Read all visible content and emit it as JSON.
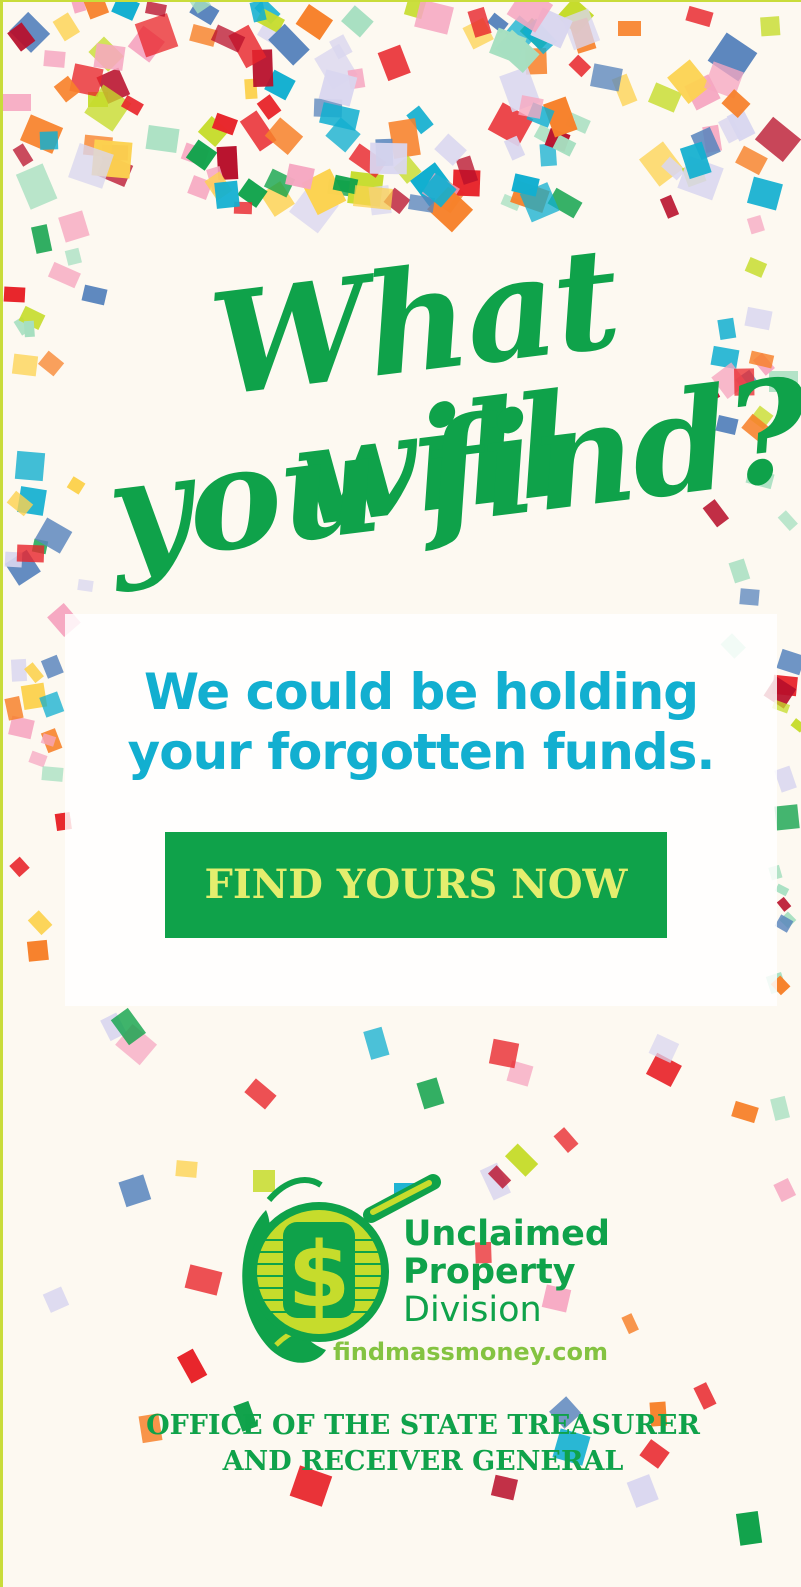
{
  "ad": {
    "headline_line1": "What will",
    "headline_line2": "you find?",
    "tagline_line1": "We could be holding",
    "tagline_line2": "your forgotten funds.",
    "cta_label": "FIND YOURS NOW",
    "logo": {
      "line1": "Unclaimed",
      "line2": "Property",
      "line3": "Division",
      "url": "findmassmoney.com",
      "icon": "dollar-magnifier-icon"
    },
    "office_line1": "OFFICE OF THE STATE TREASURER",
    "office_line2": "AND RECEIVER GENERAL"
  },
  "colors": {
    "green": "#0fa24a",
    "cyan": "#12afd0",
    "lime": "#c9dc3a",
    "cta_text": "#e4ee6e",
    "background": "#fdf9f1",
    "confetti": [
      "#e8262c",
      "#f7812a",
      "#12afd0",
      "#5a85bd",
      "#c6dc2c",
      "#f6a7c1",
      "#0fa24a",
      "#fcd250",
      "#d9d6ef",
      "#b80f2b",
      "#a6dfc0"
    ]
  }
}
